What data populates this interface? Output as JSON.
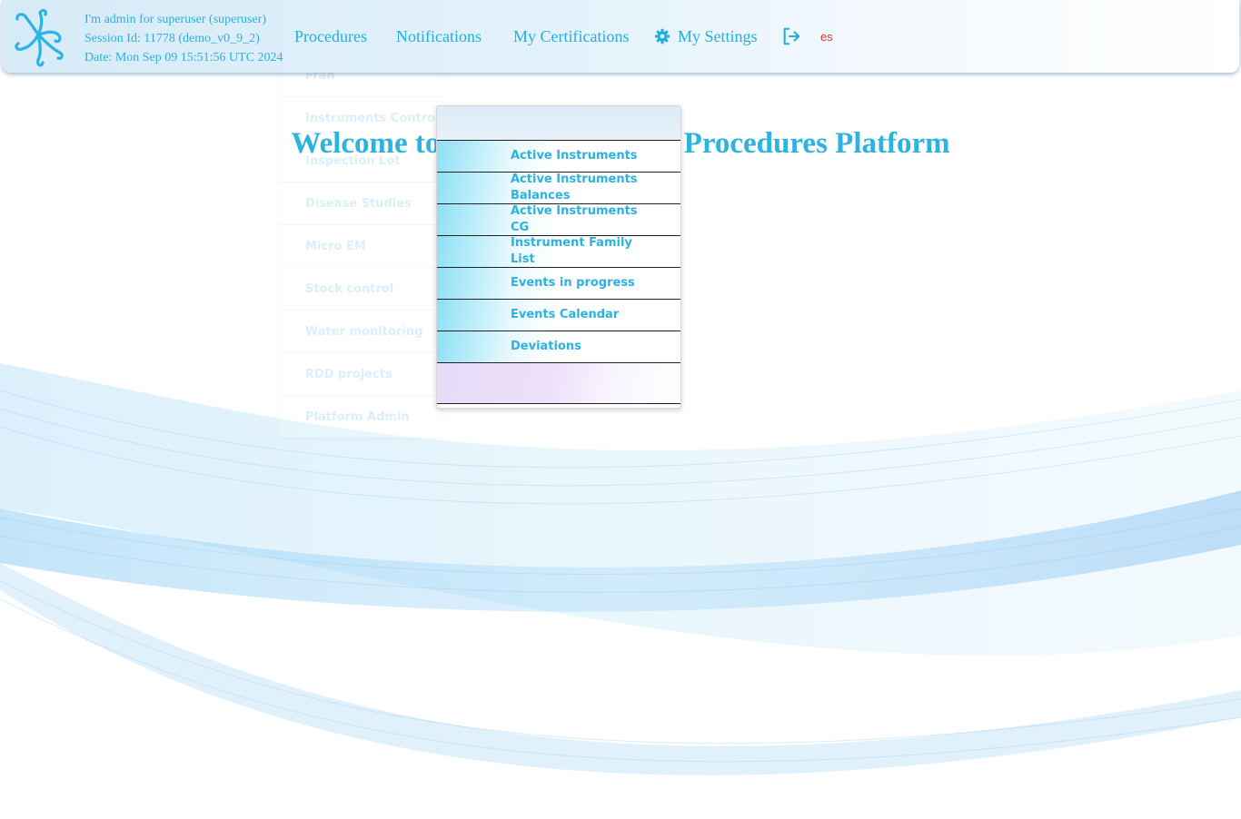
{
  "header": {
    "session_user": "I'm admin for superuser (superuser)",
    "session_id": "Session Id: 11778 (demo_v0_9_2)",
    "session_date": "Date: Mon Sep 09 15:51:56 UTC 2024",
    "nav": {
      "procedures": "Procedures",
      "notifications": "Notifications",
      "certifications": "My Certifications",
      "settings": "My Settings",
      "language": "es"
    },
    "icons": {
      "logo": "logo-icon",
      "settings": "gear-icon",
      "logout": "logout-icon"
    }
  },
  "welcome": {
    "title": "Welcome to the Trazit Quality Procedures Platform"
  },
  "side_menu": {
    "items": [
      "Fran",
      "Instruments Control",
      "Inspection Lot",
      "Disease Studies",
      "Micro EM",
      "Stock control",
      "Water monitoring",
      "RDD projects",
      "Platform Admin"
    ]
  },
  "dropdown": {
    "items": [
      "Active Instruments",
      "Active Instruments Balances",
      "Active Instruments CG",
      "Instrument Family List",
      "Events in progress",
      "Events Calendar",
      "Deviations"
    ]
  },
  "colors": {
    "accent": "#2cb3df",
    "language_link": "#d9362b",
    "dropdown_highlight": "#8fdef4",
    "wave": "#9fd3f5"
  }
}
